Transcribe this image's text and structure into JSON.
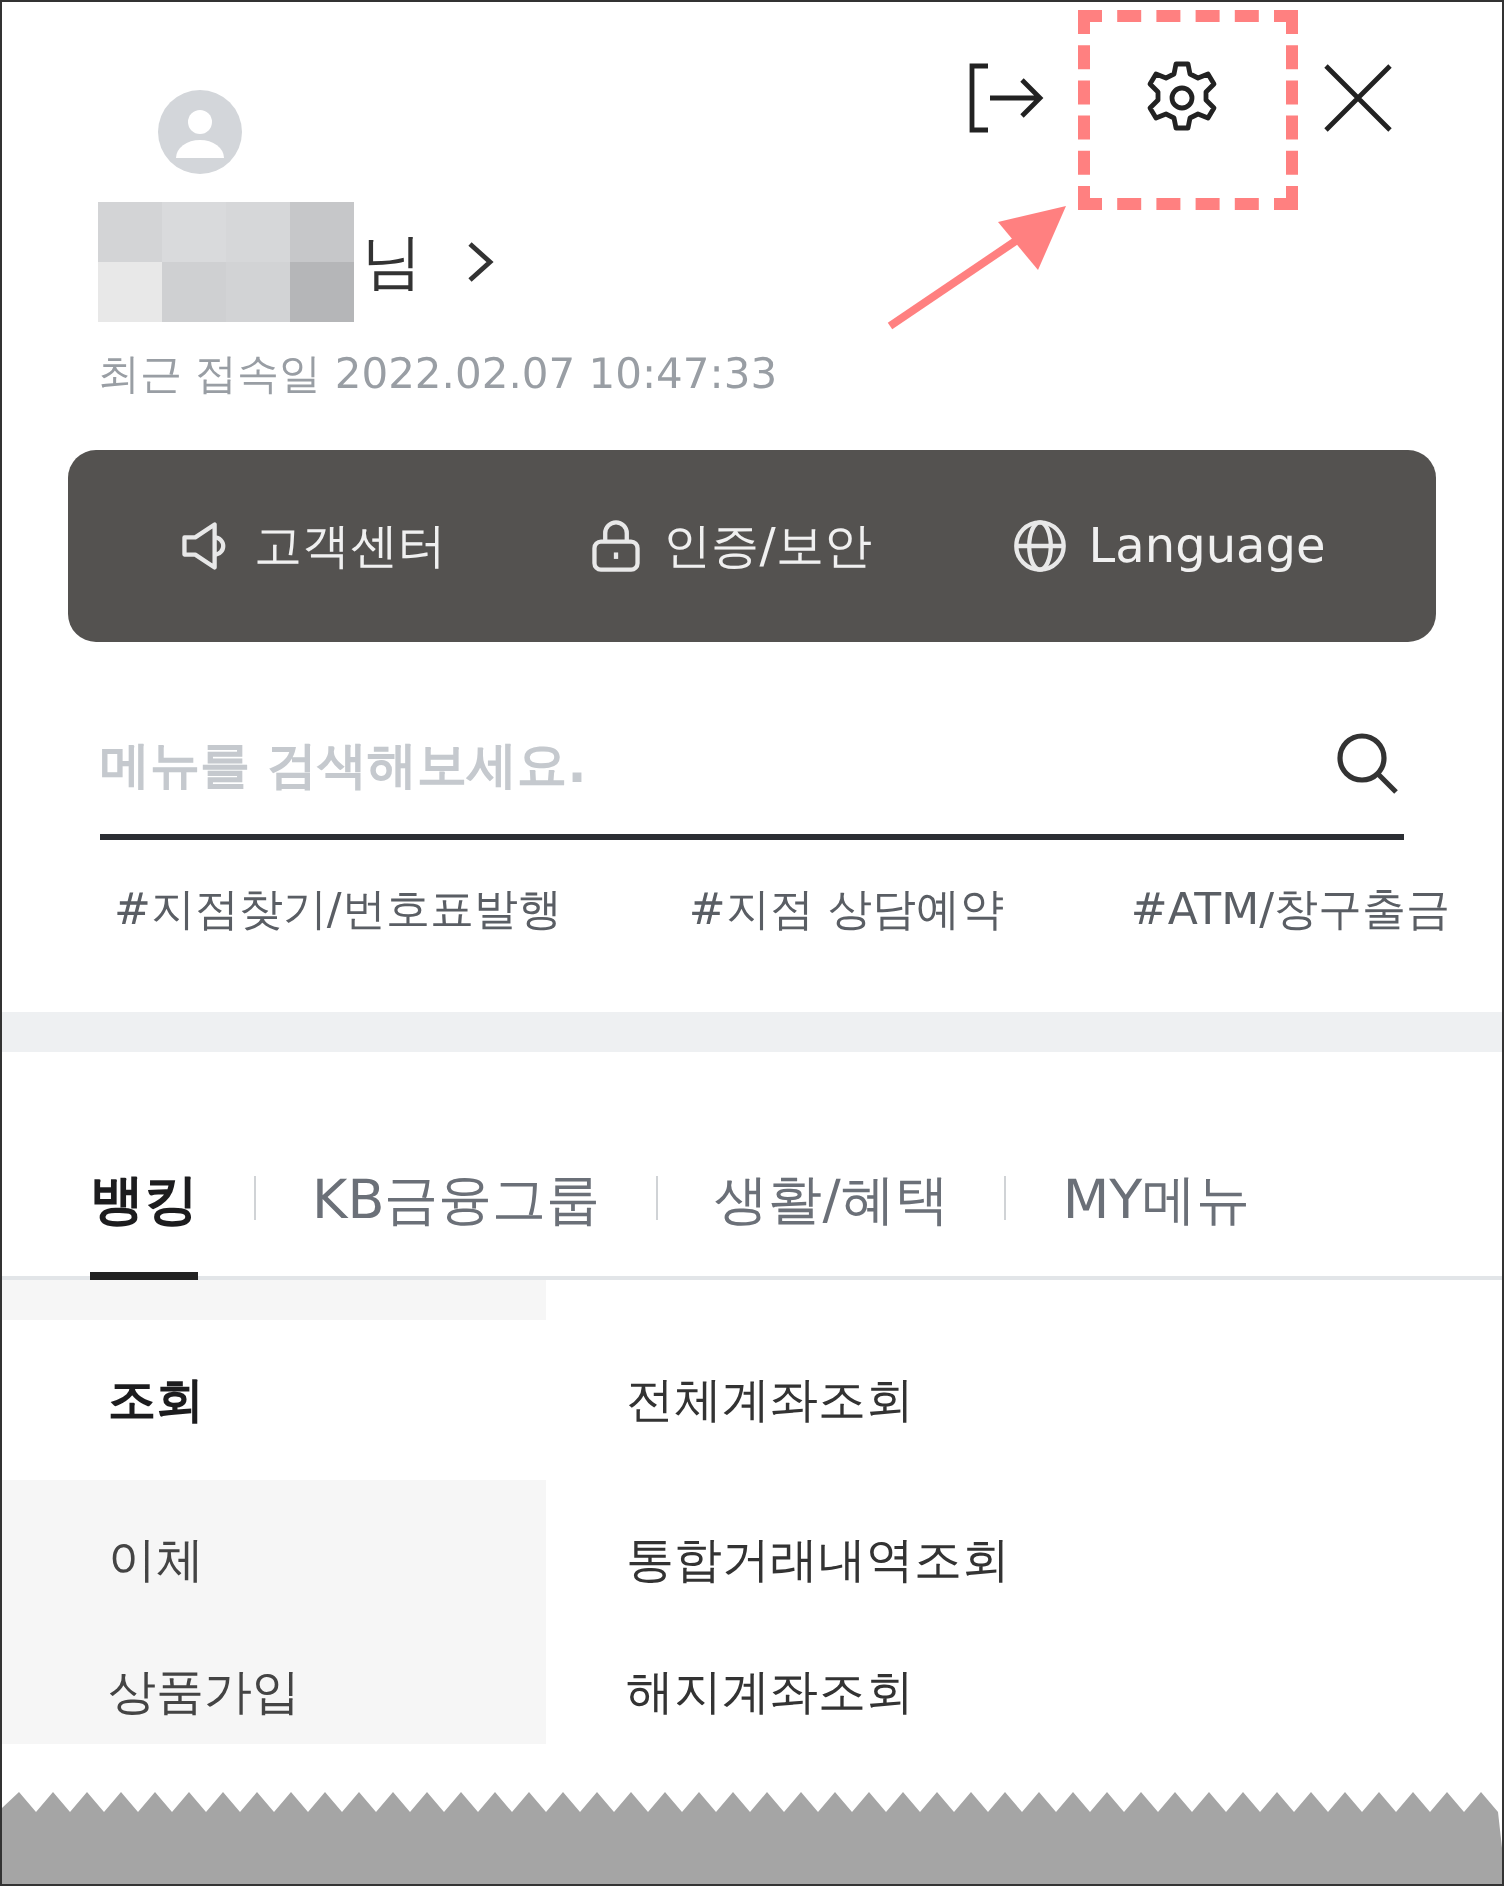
{
  "header": {
    "greeting_suffix": "님",
    "last_login": "최근 접속일 2022.02.07 10:47:33"
  },
  "quick_links": [
    {
      "kind": "speaker",
      "label": "고객센터"
    },
    {
      "kind": "lock",
      "label": "인증/보안"
    },
    {
      "kind": "globe",
      "label": "Language"
    }
  ],
  "search": {
    "placeholder": "메뉴를 검색해보세요."
  },
  "tags": [
    "#지점찾기/번호표발행",
    "#지점 상담예약",
    "#ATM/창구출금"
  ],
  "tabs": [
    {
      "label": "뱅킹",
      "selected": true
    },
    {
      "label": "KB금융그룹",
      "selected": false
    },
    {
      "label": "생활/혜택",
      "selected": false
    },
    {
      "label": "MY메뉴",
      "selected": false
    }
  ],
  "categories": [
    {
      "label": "조회",
      "selected": true
    },
    {
      "label": "이체",
      "selected": false
    },
    {
      "label": "상품가입",
      "selected": false
    }
  ],
  "menu_items": [
    "전체계좌조회",
    "통합거래내역조회",
    "해지계좌조회"
  ]
}
